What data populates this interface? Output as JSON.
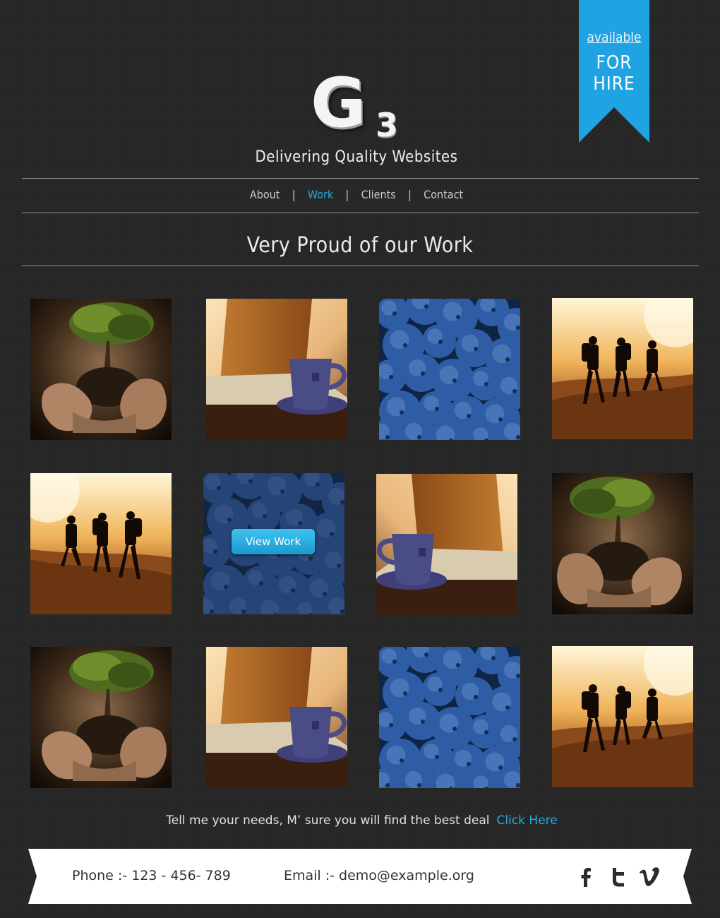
{
  "ribbon": {
    "available": "available",
    "hire": "FOR HIRE",
    "color": "#1fa3e3"
  },
  "logo": {
    "letter": "G",
    "number": "3",
    "tagline": "Delivering Quality Websites"
  },
  "nav": {
    "items": [
      {
        "label": "About",
        "active": false
      },
      {
        "label": "Work",
        "active": true
      },
      {
        "label": "Clients",
        "active": false
      },
      {
        "label": "Contact",
        "active": false
      }
    ],
    "separator": "|"
  },
  "section_title": "Very Proud of our Work",
  "portfolio": {
    "overlay_button": "View Work",
    "tiles": [
      "hands-tree",
      "laptop-cup",
      "blueberries",
      "hikers",
      "hikers",
      "blueberries",
      "laptop-cup",
      "hands-tree",
      "hands-tree",
      "laptop-cup",
      "blueberries",
      "hikers"
    ]
  },
  "cta": {
    "text": "Tell me your needs, M’ sure you will find the best deal",
    "link": "Click Here"
  },
  "footer": {
    "phone": "Phone :- 123 - 456- 789",
    "email": "Email :- demo@example.org",
    "social": [
      "facebook-icon",
      "twitter-icon",
      "vimeo-icon"
    ]
  },
  "colors": {
    "accent": "#29a9df",
    "background": "#262626"
  }
}
